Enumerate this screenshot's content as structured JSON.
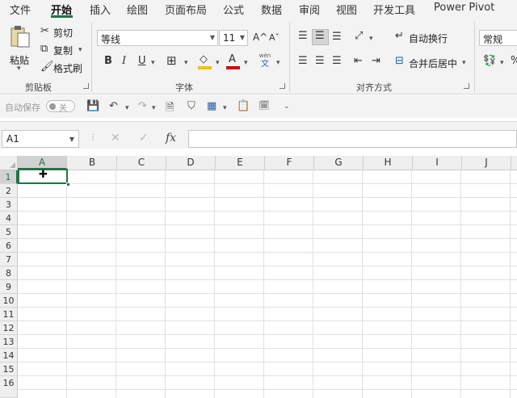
{
  "menu_tabs": [
    "文件",
    "开始",
    "插入",
    "绘图",
    "页面布局",
    "公式",
    "数据",
    "审阅",
    "视图",
    "开发工具",
    "Power Pivot"
  ],
  "active_tab": "开始",
  "clipboard": {
    "paste_label": "粘贴",
    "cut_label": "剪切",
    "copy_label": "复制",
    "format_painter_label": "格式刷",
    "group_label": "剪贴板"
  },
  "font": {
    "font_name": "等线",
    "font_size": "11",
    "group_label": "字体",
    "grow_icon": "A^",
    "shrink_icon": "Aˇ",
    "bold": "B",
    "italic": "I",
    "underline": "U",
    "font_color_letter": "A",
    "phonetic_top": "wén",
    "phonetic_bottom": "文",
    "fill_color": "#f2c200",
    "font_color": "#d40000"
  },
  "alignment": {
    "wrap_text_label": "自动换行",
    "merge_center_label": "合并后居中",
    "group_label": "对齐方式"
  },
  "number": {
    "format_value": "常规"
  },
  "qat": {
    "autosave_label": "自动保存",
    "toggle_state": "关"
  },
  "formula_bar": {
    "name_box": "A1",
    "fx_label": "fx",
    "formula": ""
  },
  "grid": {
    "columns": [
      "A",
      "B",
      "C",
      "D",
      "E",
      "F",
      "G",
      "H",
      "I",
      "J"
    ],
    "rows": [
      "1",
      "2",
      "3",
      "4",
      "5",
      "6",
      "7",
      "8",
      "9",
      "10",
      "11",
      "12",
      "13",
      "14",
      "15",
      "16"
    ],
    "active_column": "A",
    "active_row": "1"
  },
  "accent_color": "#217346"
}
